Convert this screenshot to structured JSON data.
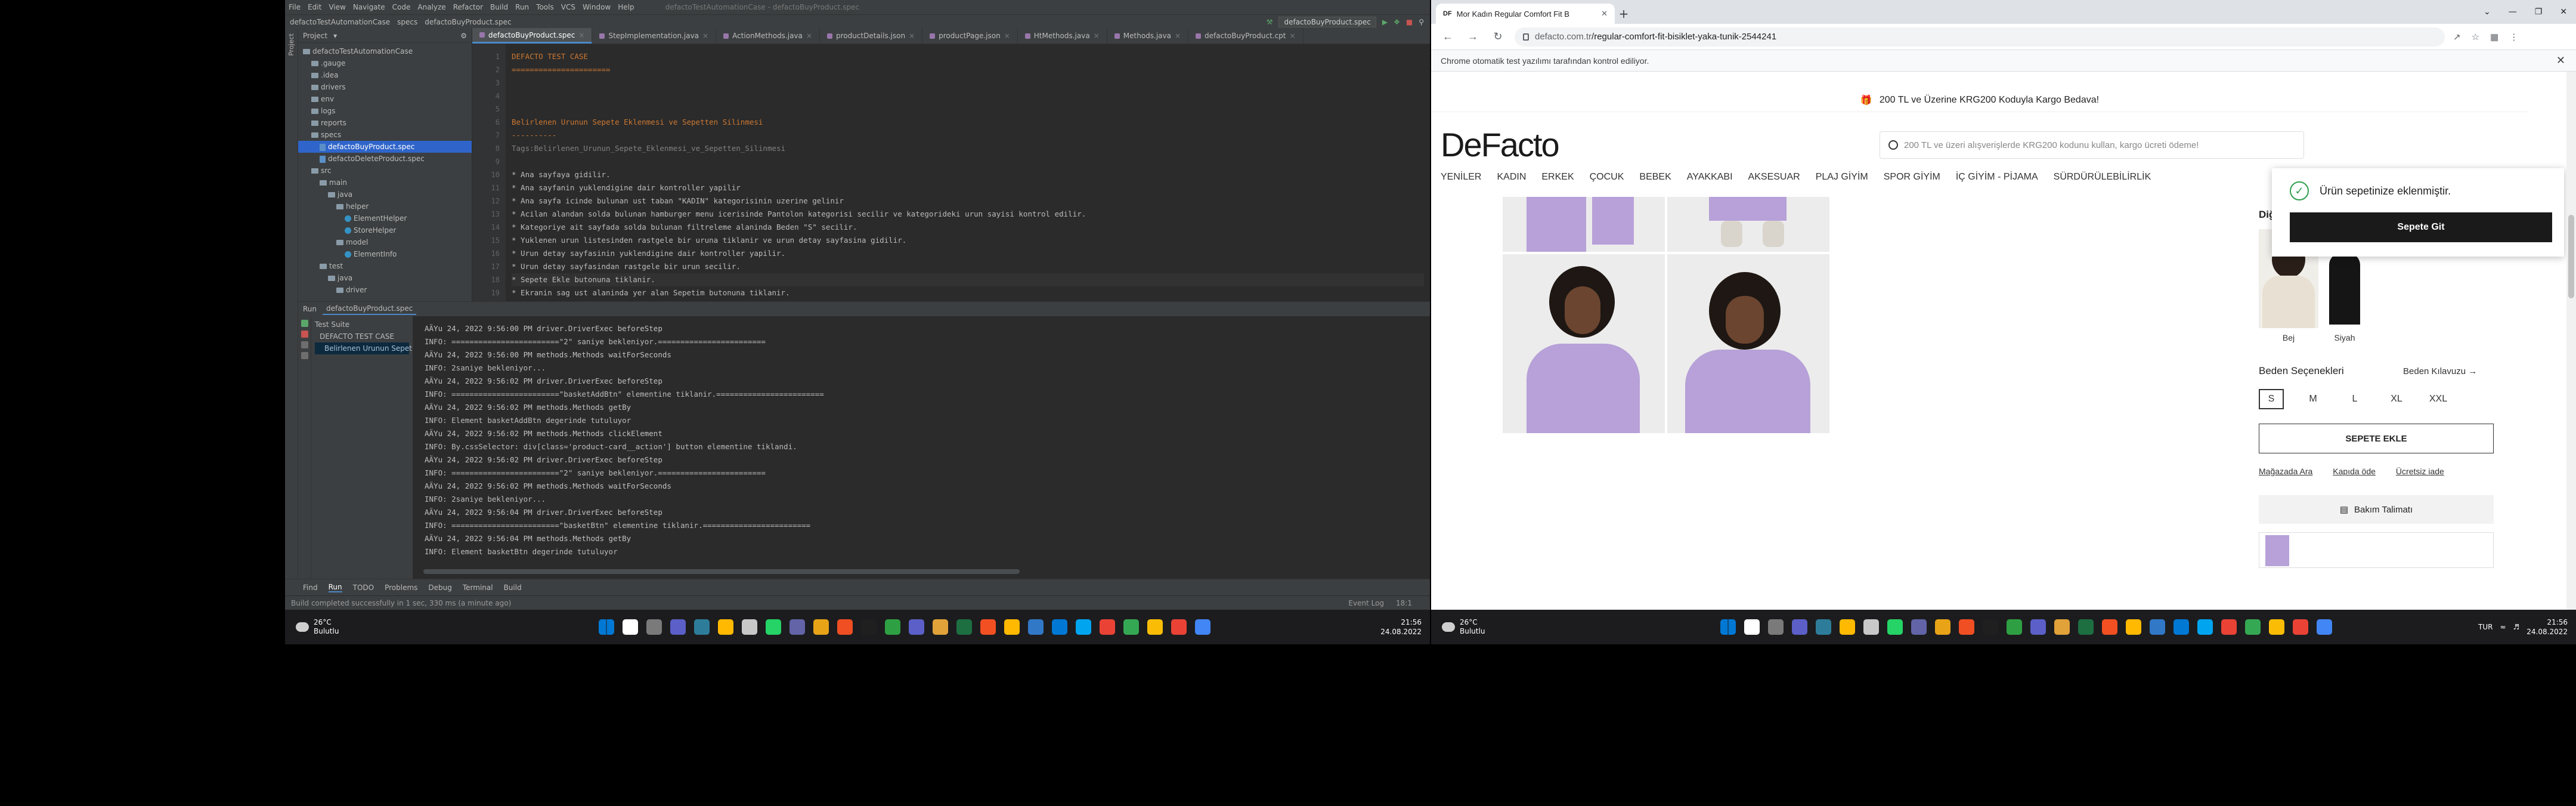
{
  "ide": {
    "project_name": "defactoTestAutomationCase",
    "menu": [
      "File",
      "Edit",
      "View",
      "Navigate",
      "Code",
      "Analyze",
      "Refactor",
      "Build",
      "Run",
      "Tools",
      "VCS",
      "Window",
      "Help"
    ],
    "window_title": "defactoTestAutomationCase - defactoBuyProduct.spec",
    "breadcrumb": [
      "defactoTestAutomationCase",
      "specs",
      "defactoBuyProduct.spec"
    ],
    "run_config": "defactoBuyProduct.spec",
    "project_label": "Project",
    "tree": [
      {
        "label": "defactoTestAutomationCase",
        "kind": "folder",
        "indent": 0
      },
      {
        "label": ".gauge",
        "kind": "folder",
        "indent": 1
      },
      {
        "label": ".idea",
        "kind": "folder",
        "indent": 1
      },
      {
        "label": "drivers",
        "kind": "folder",
        "indent": 1
      },
      {
        "label": "env",
        "kind": "folder",
        "indent": 1
      },
      {
        "label": "logs",
        "kind": "folder",
        "indent": 1
      },
      {
        "label": "reports",
        "kind": "folder",
        "indent": 1
      },
      {
        "label": "specs",
        "kind": "folder",
        "indent": 1
      },
      {
        "label": "defactoBuyProduct.spec",
        "kind": "file",
        "indent": 2
      },
      {
        "label": "defactoDeleteProduct.spec",
        "kind": "file",
        "indent": 2
      },
      {
        "label": "src",
        "kind": "folder",
        "indent": 1
      },
      {
        "label": "main",
        "kind": "folder",
        "indent": 2
      },
      {
        "label": "java",
        "kind": "folder",
        "indent": 3
      },
      {
        "label": "helper",
        "kind": "folder",
        "indent": 4
      },
      {
        "label": "ElementHelper",
        "kind": "class",
        "indent": 5
      },
      {
        "label": "StoreHelper",
        "kind": "class",
        "indent": 5
      },
      {
        "label": "model",
        "kind": "folder",
        "indent": 4
      },
      {
        "label": "ElementInfo",
        "kind": "class",
        "indent": 5
      },
      {
        "label": "test",
        "kind": "folder",
        "indent": 2
      },
      {
        "label": "java",
        "kind": "folder",
        "indent": 3
      },
      {
        "label": "driver",
        "kind": "folder",
        "indent": 4
      }
    ],
    "tabs": [
      "defactoBuyProduct.spec",
      "StepImplementation.java",
      "ActionMethods.java",
      "productDetails.json",
      "productPage.json",
      "HtMethods.java",
      "Methods.java",
      "defactoBuyProduct.cpt"
    ],
    "active_tab": 0,
    "line_numbers": [
      "1",
      "2",
      "3",
      "4",
      "5",
      "6",
      "7",
      "8",
      "9",
      "10",
      "11",
      "12",
      "13",
      "14",
      "15",
      "16",
      "17",
      "18",
      "19"
    ],
    "code": [
      {
        "cls": "c-h",
        "text": "DEFACTO TEST CASE"
      },
      {
        "cls": "c-h",
        "text": "======================"
      },
      {
        "cls": "c-t",
        "text": ""
      },
      {
        "cls": "c-t",
        "text": ""
      },
      {
        "cls": "c-t",
        "text": ""
      },
      {
        "cls": "c-h",
        "text": "Belirlenen Urunun Sepete Eklenmesi ve Sepetten Silinmesi"
      },
      {
        "cls": "c-h",
        "text": "----------"
      },
      {
        "cls": "c-c",
        "text": "Tags:Belirlenen_Urunun_Sepete_Eklenmesi_ve_Sepetten_Silinmesi"
      },
      {
        "cls": "c-t",
        "text": ""
      },
      {
        "cls": "c-t",
        "text": "* Ana sayfaya gidilir."
      },
      {
        "cls": "c-t",
        "text": "* Ana sayfanin yuklendigine dair kontroller yapilir"
      },
      {
        "cls": "c-t",
        "text": "* Ana sayfa icinde bulunan ust taban \"KADIN\" kategorisinin uzerine gelinir"
      },
      {
        "cls": "c-t",
        "text": "* Acilan alandan solda bulunan hamburger menu icerisinde Pantolon kategorisi secilir ve kategorideki urun sayisi kontrol edilir."
      },
      {
        "cls": "c-t",
        "text": "* Kategoriye ait sayfada solda bulunan filtreleme alaninda Beden \"S\" secilir."
      },
      {
        "cls": "c-t",
        "text": "* Yuklenen urun listesinden rastgele bir uruna tiklanir ve urun detay sayfasina gidilir."
      },
      {
        "cls": "c-t",
        "text": "* Urun detay sayfasinin yuklendigine dair kontroller yapilir."
      },
      {
        "cls": "c-t",
        "text": "* Urun detay sayfasindan rastgele bir urun secilir."
      },
      {
        "cls": "c-t",
        "text": "* Sepete Ekle butonuna tiklanir."
      },
      {
        "cls": "c-t",
        "text": "* Ekranin sag ust alaninda yer alan Sepetim butonuna tiklanir."
      }
    ],
    "run_tab_label": "defactoBuyProduct.spec",
    "run_label": "Run",
    "test_tree": [
      "Test Suite",
      "DEFACTO TEST CASE",
      "Belirlenen Urunun Sepet"
    ],
    "console": [
      "AÄYu 24, 2022 9:56:00 PM driver.DriverExec beforeStep",
      "INFO: ========================\"2\" saniye bekleniyor.========================",
      "AÄYu 24, 2022 9:56:00 PM methods.Methods waitForSeconds",
      "INFO: 2saniye bekleniyor...",
      "AÄYu 24, 2022 9:56:02 PM driver.DriverExec beforeStep",
      "INFO: ========================\"basketAddBtn\" elementine tiklanir.========================",
      "AÄYu 24, 2022 9:56:02 PM methods.Methods getBy",
      "INFO: Element basketAddBtn degerinde tutuluyor",
      "AÄYu 24, 2022 9:56:02 PM methods.Methods clickElement",
      "INFO: By.cssSelector: div[class='product-card__action'] button elementine tiklandi.",
      "AÄYu 24, 2022 9:56:02 PM driver.DriverExec beforeStep",
      "INFO: ========================\"2\" saniye bekleniyor.========================",
      "AÄYu 24, 2022 9:56:02 PM methods.Methods waitForSeconds",
      "INFO: 2saniye bekleniyor...",
      "AÄYu 24, 2022 9:56:04 PM driver.DriverExec beforeStep",
      "INFO: ========================\"basketBtn\" elementine tiklanir.========================",
      "AÄYu 24, 2022 9:56:04 PM methods.Methods getBy",
      "INFO: Element basketBtn degerinde tutuluyor"
    ],
    "bottom_tabs": [
      "Find",
      "Run",
      "TODO",
      "Problems",
      "Debug",
      "Terminal",
      "Build"
    ],
    "status_left": "Build completed successfully in 1 sec, 330 ms (a minute ago)",
    "status_right": [
      "Event Log",
      "18:1"
    ]
  },
  "taskbar_left": {
    "temp": "26°C",
    "condition": "Bulutlu",
    "time": "21:56",
    "date": "24.08.2022"
  },
  "browser": {
    "tab_title": "Mor Kadın Regular Comfort Fit B",
    "tab_favicon": "DF",
    "url_host": "defacto.com.tr",
    "url_path": "/regular-comfort-fit-bisiklet-yaka-tunik-2544241",
    "infobar": "Chrome otomatik test yazılımı tarafından kontrol ediliyor.",
    "promo": "200 TL ve Üzerine KRG200 Koduyla Kargo Bedava!",
    "logo": "DeFacto",
    "search_placeholder": "200 TL ve üzeri alışverişlerde KRG200 kodunu kullan, kargo ücreti ödeme!",
    "menu": [
      "YENİLER",
      "KADIN",
      "ERKEK",
      "ÇOCUK",
      "BEBEK",
      "AYAKKABI",
      "AKSESUAR",
      "PLAJ GİYİM",
      "SPOR GİYİM",
      "İÇ GİYİM - PİJAMA",
      "SÜRDÜRÜLEBİLİRLİK"
    ],
    "colors_title": "Diğer 2 Renk",
    "colors": [
      "Bej",
      "Siyah"
    ],
    "size_title": "Beden Seçenekleri",
    "size_guide": "Beden Kılavuzu →",
    "sizes": [
      "S",
      "M",
      "L",
      "XL",
      "XXL"
    ],
    "selected_size": "S",
    "add_to_cart": "SEPETE EKLE",
    "links": [
      "Mağazada Ara",
      "Kapıda öde",
      "Ücretsiz iade"
    ],
    "care": "Bakım Talimatı",
    "toast_msg": "Ürün sepetinize eklenmiştir.",
    "toast_btn": "Sepete Git",
    "brand_color": "#1a1a1a",
    "success_color": "#2e9e4d"
  },
  "taskbar_right": {
    "temp": "26°C",
    "condition": "Bulutlu",
    "lang": "TUR",
    "time": "21:56",
    "date": "24.08.2022"
  }
}
